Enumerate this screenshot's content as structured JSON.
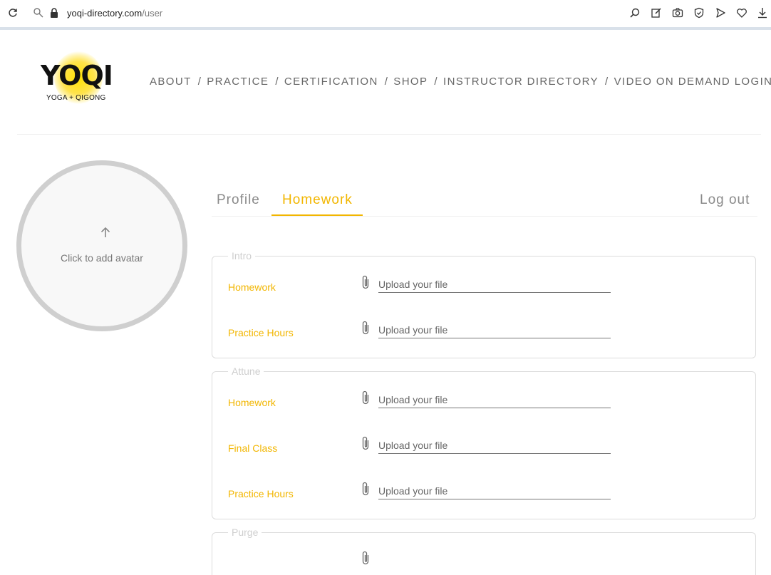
{
  "browser": {
    "url_host": "yoqi-directory.com",
    "url_path": "/user"
  },
  "logo": {
    "word": "YOQI",
    "tagline": "YOGA + QIGONG"
  },
  "nav": {
    "items": [
      "ABOUT",
      "PRACTICE",
      "CERTIFICATION",
      "SHOP",
      "INSTRUCTOR DIRECTORY",
      "VIDEO ON DEMAND LOGIN"
    ],
    "separator": "/"
  },
  "avatar": {
    "label": "Click to add avatar"
  },
  "tabs": {
    "profile": "Profile",
    "homework": "Homework",
    "logout": "Log out",
    "active": "Homework",
    "accent_color": "#f2b600"
  },
  "groups": [
    {
      "legend": "Intro",
      "rows": [
        {
          "label": "Homework",
          "placeholder": "Upload your file"
        },
        {
          "label": "Practice Hours",
          "placeholder": "Upload your file"
        }
      ]
    },
    {
      "legend": "Attune",
      "rows": [
        {
          "label": "Homework",
          "placeholder": "Upload your file"
        },
        {
          "label": "Final Class",
          "placeholder": "Upload your file"
        },
        {
          "label": "Practice Hours",
          "placeholder": "Upload your file"
        }
      ]
    },
    {
      "legend": "Purge",
      "rows": []
    }
  ]
}
